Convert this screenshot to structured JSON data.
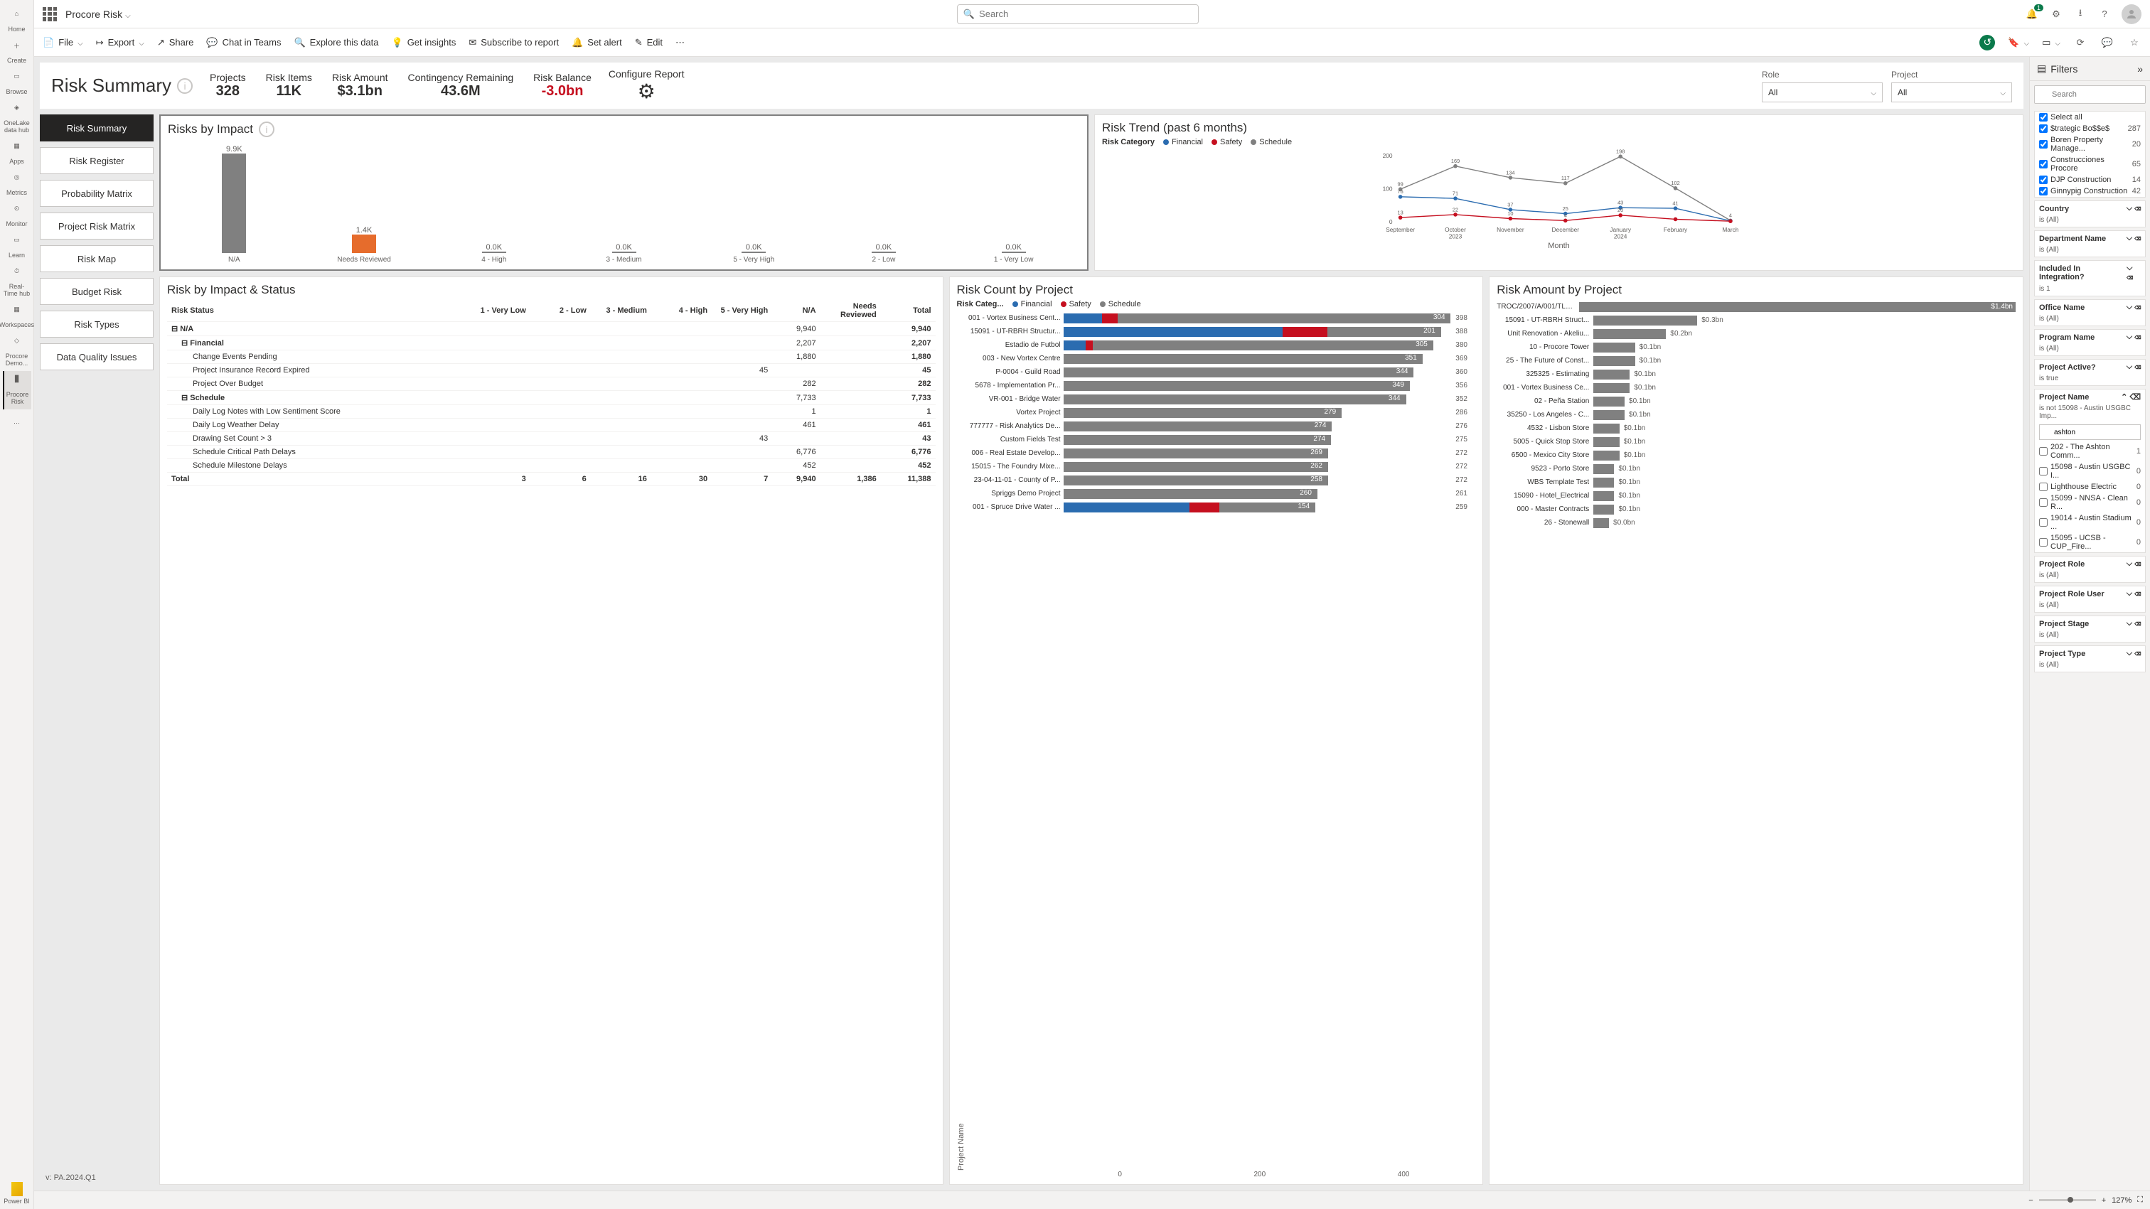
{
  "app": {
    "name": "Procore Risk"
  },
  "search": {
    "placeholder": "Search"
  },
  "notifications": {
    "count": "1"
  },
  "rail": [
    {
      "label": "Home"
    },
    {
      "label": "Create"
    },
    {
      "label": "Browse"
    },
    {
      "label": "OneLake data hub"
    },
    {
      "label": "Apps"
    },
    {
      "label": "Metrics"
    },
    {
      "label": "Monitor"
    },
    {
      "label": "Learn"
    },
    {
      "label": "Real-Time hub"
    },
    {
      "label": "Workspaces"
    },
    {
      "label": "Procore Demo..."
    },
    {
      "label": "Procore Risk"
    }
  ],
  "rail_footer": {
    "label": "Power BI"
  },
  "toolbar": {
    "file": "File",
    "export": "Export",
    "share": "Share",
    "chat": "Chat in Teams",
    "explore": "Explore this data",
    "insights": "Get insights",
    "subscribe": "Subscribe to report",
    "alert": "Set alert",
    "edit": "Edit"
  },
  "header": {
    "title": "Risk Summary",
    "kpis": [
      {
        "label": "Projects",
        "value": "328"
      },
      {
        "label": "Risk Items",
        "value": "11K"
      },
      {
        "label": "Risk Amount",
        "value": "$3.1bn"
      },
      {
        "label": "Contingency Remaining",
        "value": "43.6M"
      },
      {
        "label": "Risk Balance",
        "value": "-3.0bn",
        "neg": true
      }
    ],
    "configure": "Configure Report",
    "slicers": [
      {
        "label": "Role",
        "value": "All"
      },
      {
        "label": "Project",
        "value": "All"
      }
    ]
  },
  "nav": [
    "Risk Summary",
    "Risk Register",
    "Probability Matrix",
    "Project Risk Matrix",
    "Risk Map",
    "Budget Risk",
    "Risk Types",
    "Data Quality Issues"
  ],
  "version": "v: PA.2024.Q1",
  "risks_by_impact": {
    "title": "Risks by Impact",
    "bars": [
      {
        "label": "N/A",
        "value": "9.9K",
        "h": 140,
        "color": "#808080"
      },
      {
        "label": "Needs Reviewed",
        "value": "1.4K",
        "h": 26,
        "color": "#e66c2c"
      },
      {
        "label": "4 - High",
        "value": "0.0K",
        "h": 2,
        "color": "#808080"
      },
      {
        "label": "3 - Medium",
        "value": "0.0K",
        "h": 2,
        "color": "#808080"
      },
      {
        "label": "5 - Very High",
        "value": "0.0K",
        "h": 2,
        "color": "#808080"
      },
      {
        "label": "2 - Low",
        "value": "0.0K",
        "h": 2,
        "color": "#808080"
      },
      {
        "label": "1 - Very Low",
        "value": "0.0K",
        "h": 2,
        "color": "#808080"
      }
    ]
  },
  "chart_data": {
    "type": "line",
    "title": "Risk Trend (past 6 months)",
    "legend_label": "Risk Category",
    "series_names": [
      "Financial",
      "Safety",
      "Schedule"
    ],
    "colors": {
      "Financial": "#2b6cb0",
      "Safety": "#c50f1f",
      "Schedule": "#808080"
    },
    "categories": [
      "September",
      "October",
      "November",
      "December",
      "January",
      "February",
      "March"
    ],
    "year_labels": {
      "October": "2023",
      "January": "2024"
    },
    "ylim": [
      0,
      200
    ],
    "series": [
      {
        "name": "Schedule",
        "values": [
          99,
          169,
          134,
          117,
          198,
          102,
          4
        ],
        "labels": [
          "99",
          "169",
          "134",
          "117",
          "198",
          "102",
          "4"
        ]
      },
      {
        "name": "Financial",
        "values": [
          76,
          71,
          37,
          25,
          43,
          41,
          3
        ],
        "labels": [
          "76",
          "71",
          "37",
          "25",
          "43",
          "41",
          ""
        ]
      },
      {
        "name": "Safety",
        "values": [
          13,
          22,
          10,
          4,
          20,
          8,
          2
        ],
        "labels": [
          "13",
          "22",
          "10",
          "4",
          "20",
          "",
          ""
        ]
      }
    ],
    "xlabel": "Month"
  },
  "matrix": {
    "title": "Risk by Impact & Status",
    "status_label": "Risk Status",
    "cols": [
      "1 - Very Low",
      "2 - Low",
      "3 - Medium",
      "4 - High",
      "5 - Very High",
      "N/A",
      "Needs Reviewed",
      "Total"
    ],
    "rows": [
      {
        "label": "N/A",
        "cls": "grp",
        "ind": 0,
        "vals": [
          "",
          "",
          "",
          "",
          "",
          "9,940",
          "",
          "9,940"
        ]
      },
      {
        "label": "Financial",
        "cls": "grp",
        "ind": 1,
        "vals": [
          "",
          "",
          "",
          "",
          "",
          "2,207",
          "",
          "2,207"
        ]
      },
      {
        "label": "Change Events Pending",
        "ind": 2,
        "vals": [
          "",
          "",
          "",
          "",
          "",
          "1,880",
          "",
          "1,880"
        ]
      },
      {
        "label": "Project Insurance Record Expired",
        "ind": 2,
        "vals": [
          "",
          "",
          "",
          "",
          "45",
          "",
          "",
          "45"
        ]
      },
      {
        "label": "Project Over Budget",
        "ind": 2,
        "vals": [
          "",
          "",
          "",
          "",
          "",
          "282",
          "",
          "282"
        ]
      },
      {
        "label": "Schedule",
        "cls": "grp",
        "ind": 1,
        "vals": [
          "",
          "",
          "",
          "",
          "",
          "7,733",
          "",
          "7,733"
        ]
      },
      {
        "label": "Daily Log Notes with Low Sentiment Score",
        "ind": 2,
        "vals": [
          "",
          "",
          "",
          "",
          "",
          "1",
          "",
          "1"
        ]
      },
      {
        "label": "Daily Log Weather Delay",
        "ind": 2,
        "vals": [
          "",
          "",
          "",
          "",
          "",
          "461",
          "",
          "461"
        ]
      },
      {
        "label": "Drawing Set Count > 3",
        "ind": 2,
        "vals": [
          "",
          "",
          "",
          "",
          "43",
          "",
          "",
          "43"
        ]
      },
      {
        "label": "Schedule Critical Path Delays",
        "ind": 2,
        "vals": [
          "",
          "",
          "",
          "",
          "",
          "6,776",
          "",
          "6,776"
        ]
      },
      {
        "label": "Schedule Milestone Delays",
        "ind": 2,
        "vals": [
          "",
          "",
          "",
          "",
          "",
          "452",
          "",
          "452"
        ]
      }
    ],
    "total": {
      "label": "Total",
      "vals": [
        "3",
        "6",
        "16",
        "30",
        "7",
        "9,940",
        "1,386",
        "11,388"
      ]
    }
  },
  "risk_count": {
    "title": "Risk Count by Project",
    "legend_label": "Risk Categ...",
    "axis_label": "Project Name",
    "axis_ticks": [
      "0",
      "200",
      "400"
    ],
    "rows": [
      {
        "label": "001 - Vortex Business Cent...",
        "seg": [
          [
            "#2b6cb0",
            10
          ],
          [
            "#c50f1f",
            4
          ],
          [
            "#808080",
            86
          ]
        ],
        "val": "304",
        "total": "398"
      },
      {
        "label": "15091 - UT-RBRH Structur...",
        "seg": [
          [
            "#2b6cb0",
            58
          ],
          [
            "#c50f1f",
            12
          ],
          [
            "#808080",
            30
          ]
        ],
        "val": "201",
        "total": "388"
      },
      {
        "label": "Estadio de Futbol",
        "seg": [
          [
            "#2b6cb0",
            6
          ],
          [
            "#c50f1f",
            2
          ],
          [
            "#808080",
            92
          ]
        ],
        "val": "305",
        "total": "380"
      },
      {
        "label": "003 - New Vortex Centre",
        "seg": [
          [
            "#808080",
            100
          ]
        ],
        "val": "351",
        "total": "369"
      },
      {
        "label": "P-0004 - Guild Road",
        "seg": [
          [
            "#808080",
            100
          ]
        ],
        "val": "344",
        "total": "360"
      },
      {
        "label": "5678 - Implementation Pr...",
        "seg": [
          [
            "#808080",
            100
          ]
        ],
        "val": "349",
        "total": "356"
      },
      {
        "label": "VR-001 - Bridge Water",
        "seg": [
          [
            "#808080",
            100
          ]
        ],
        "val": "344",
        "total": "352"
      },
      {
        "label": "Vortex Project",
        "seg": [
          [
            "#808080",
            100
          ]
        ],
        "val": "279",
        "total": "286"
      },
      {
        "label": "777777 - Risk Analytics De...",
        "seg": [
          [
            "#808080",
            100
          ]
        ],
        "val": "274",
        "total": "276"
      },
      {
        "label": "Custom Fields Test",
        "seg": [
          [
            "#808080",
            100
          ]
        ],
        "val": "274",
        "total": "275"
      },
      {
        "label": "006 - Real Estate Develop...",
        "seg": [
          [
            "#808080",
            100
          ]
        ],
        "val": "269",
        "total": "272"
      },
      {
        "label": "15015 - The Foundry Mixe...",
        "seg": [
          [
            "#808080",
            100
          ]
        ],
        "val": "262",
        "total": "272"
      },
      {
        "label": "23-04-11-01 - County of P...",
        "seg": [
          [
            "#808080",
            100
          ]
        ],
        "val": "258",
        "total": "272"
      },
      {
        "label": "Spriggs Demo Project",
        "seg": [
          [
            "#808080",
            100
          ]
        ],
        "val": "260",
        "total": "261"
      },
      {
        "label": "001 - Spruce Drive Water ...",
        "seg": [
          [
            "#2b6cb0",
            50
          ],
          [
            "#c50f1f",
            12
          ],
          [
            "#808080",
            38
          ]
        ],
        "val": "154",
        "total": "259"
      }
    ]
  },
  "risk_amount": {
    "title": "Risk Amount by Project",
    "rows": [
      {
        "label": "TROC/2007/A/001/TLEL ...",
        "val": "$1.4bn",
        "w": 100
      },
      {
        "label": "15091 - UT-RBRH Struct...",
        "val": "$0.3bn",
        "w": 20
      },
      {
        "label": "Unit Renovation - Akeliu...",
        "val": "$0.2bn",
        "w": 14
      },
      {
        "label": "10 - Procore Tower",
        "val": "$0.1bn",
        "w": 8
      },
      {
        "label": "25 - The Future of Const...",
        "val": "$0.1bn",
        "w": 8
      },
      {
        "label": "325325 - Estimating",
        "val": "$0.1bn",
        "w": 7
      },
      {
        "label": "001 - Vortex Business Ce...",
        "val": "$0.1bn",
        "w": 7
      },
      {
        "label": "02 - Peña Station",
        "val": "$0.1bn",
        "w": 6
      },
      {
        "label": "35250 - Los Angeles - C...",
        "val": "$0.1bn",
        "w": 6
      },
      {
        "label": "4532 - Lisbon Store",
        "val": "$0.1bn",
        "w": 5
      },
      {
        "label": "5005 - Quick Stop Store",
        "val": "$0.1bn",
        "w": 5
      },
      {
        "label": "6500 - Mexico City Store",
        "val": "$0.1bn",
        "w": 5
      },
      {
        "label": "9523 - Porto Store",
        "val": "$0.1bn",
        "w": 4
      },
      {
        "label": "WBS Template Test",
        "val": "$0.1bn",
        "w": 4
      },
      {
        "label": "15090 - Hotel_Electrical",
        "val": "$0.1bn",
        "w": 4
      },
      {
        "label": "000 - Master Contracts",
        "val": "$0.1bn",
        "w": 4
      },
      {
        "label": "26 - Stonewall",
        "val": "$0.0bn",
        "w": 3
      }
    ]
  },
  "filters": {
    "title": "Filters",
    "search_placeholder": "Search",
    "top_checks": [
      {
        "label": "Select all",
        "count": ""
      },
      {
        "label": "$trategic Bo$$e$",
        "count": "287"
      },
      {
        "label": "Boren Property Manage...",
        "count": "20"
      },
      {
        "label": "Construcciones Procore",
        "count": "65"
      },
      {
        "label": "DJP Construction",
        "count": "14"
      },
      {
        "label": "Ginnypig Construction",
        "count": "42"
      }
    ],
    "cards": [
      {
        "name": "Country",
        "sub": "is (All)"
      },
      {
        "name": "Department Name",
        "sub": "is (All)"
      },
      {
        "name": "Included In Integration?",
        "sub": "is 1"
      },
      {
        "name": "Office Name",
        "sub": "is (All)"
      },
      {
        "name": "Program Name",
        "sub": "is (All)"
      },
      {
        "name": "Project Active?",
        "sub": "is true"
      }
    ],
    "project_name": {
      "name": "Project Name",
      "sub": "is not 15098 - Austin USGBC Imp...",
      "search_value": "ashton",
      "items": [
        {
          "label": "202 - The Ashton Comm...",
          "count": "1"
        },
        {
          "label": "15098 - Austin USGBC I...",
          "count": "0"
        },
        {
          "label": "Lighthouse Electric",
          "count": "0"
        },
        {
          "label": "15099 - NNSA - Clean R...",
          "count": "0"
        },
        {
          "label": "19014 - Austin Stadium ...",
          "count": "0"
        },
        {
          "label": "15095 - UCSB - CUP_Fire...",
          "count": "0"
        }
      ]
    },
    "cards2": [
      {
        "name": "Project Role",
        "sub": "is (All)"
      },
      {
        "name": "Project Role User",
        "sub": "is (All)"
      },
      {
        "name": "Project Stage",
        "sub": "is (All)"
      },
      {
        "name": "Project Type",
        "sub": "is (All)"
      }
    ]
  },
  "zoom": {
    "level": "127%"
  }
}
